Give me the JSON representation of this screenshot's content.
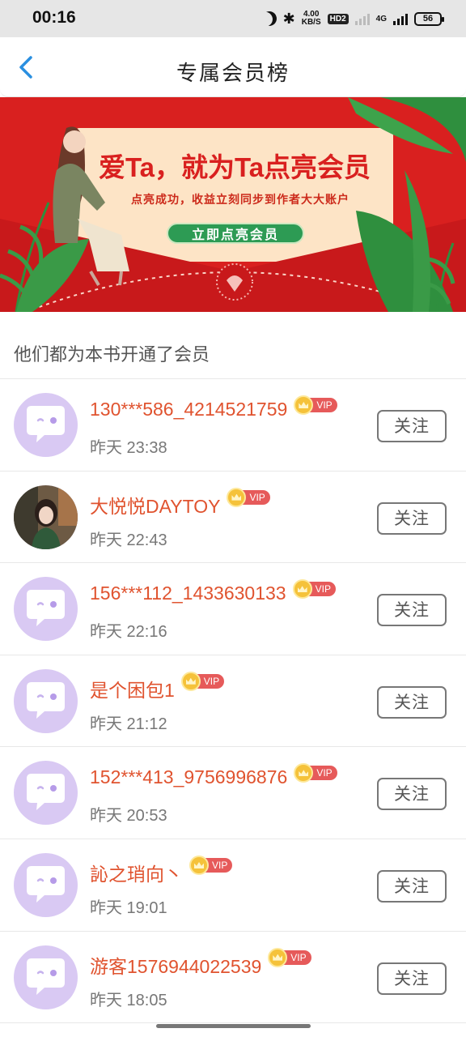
{
  "status_bar": {
    "time": "00:16",
    "speed_value": "4.00",
    "speed_unit": "KB/S",
    "hd_label": "HD2",
    "network_label": "4G",
    "battery": "56"
  },
  "header": {
    "title": "专属会员榜"
  },
  "banner": {
    "headline": "爱Ta，就为Ta点亮会员",
    "subtitle": "点亮成功，收益立刻同步到作者大大账户",
    "button_label": "立即点亮会员"
  },
  "section": {
    "title": "他们都为本书开通了会员"
  },
  "members": [
    {
      "name": "130***586_4214521759",
      "time": "昨天 23:38",
      "vip_label": "VIP",
      "follow_label": "关注",
      "avatar": "default-chat-avatar"
    },
    {
      "name": "大悦悦DAYTOY",
      "time": "昨天 22:43",
      "vip_label": "VIP",
      "follow_label": "关注",
      "avatar": "photo-avatar"
    },
    {
      "name": "156***112_1433630133",
      "time": "昨天 22:16",
      "vip_label": "VIP",
      "follow_label": "关注",
      "avatar": "default-chat-avatar"
    },
    {
      "name": "是个困包1",
      "time": "昨天 21:12",
      "vip_label": "VIP",
      "follow_label": "关注",
      "avatar": "default-chat-avatar"
    },
    {
      "name": "152***413_9756996876",
      "time": "昨天 20:53",
      "vip_label": "VIP",
      "follow_label": "关注",
      "avatar": "default-chat-avatar"
    },
    {
      "name": "訫之琑向丶",
      "time": "昨天 19:01",
      "vip_label": "VIP",
      "follow_label": "关注",
      "avatar": "default-chat-avatar"
    },
    {
      "name": "游客1576944022539",
      "time": "昨天 18:05",
      "vip_label": "VIP",
      "follow_label": "关注",
      "avatar": "default-chat-avatar"
    }
  ],
  "colors": {
    "accent_red": "#d9201f",
    "name_orange": "#e0532f",
    "vip_tag": "#e65a5a",
    "back_blue": "#2a8fe0",
    "avatar_bg": "#d9c9f3"
  }
}
